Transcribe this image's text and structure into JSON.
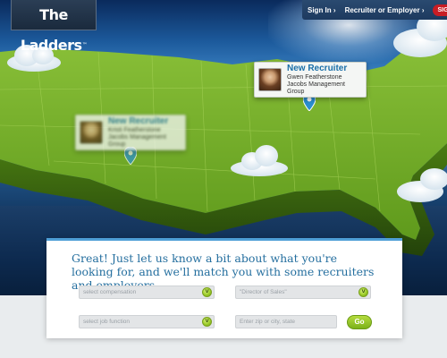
{
  "brand": {
    "logo_text": "The Ladders",
    "logo_mark": "™"
  },
  "topnav": {
    "sign_in": "Sign In ›",
    "recruiter_or_employer": "Recruiter or Employer ›",
    "sign_up": "SIGN UP"
  },
  "cards": [
    {
      "title": "New Recruiter",
      "name": "Gwen Featherstone",
      "company": "Jacobs Management Group"
    },
    {
      "title": "New Recruiter",
      "name": "Kristi Featherstone",
      "company": "Jacobs Management Group"
    }
  ],
  "form": {
    "headline": "Great! Just let us know a bit about what you're looking for, and we'll match you with some recruiters and employers.",
    "compensation": {
      "placeholder": "select compensation"
    },
    "title": {
      "value": "\"Director of Sales\""
    },
    "job_function": {
      "placeholder": "select job function"
    },
    "location": {
      "placeholder": "Enter zip or city, state"
    },
    "go_label": "Go"
  },
  "colors": {
    "accent": "#256f9f",
    "go": "#7cb11a",
    "signup": "#c81d24",
    "map_green": "#7fb42a"
  },
  "icons": {
    "dropdown": "chevron-down-icon",
    "pin": "map-pin-icon"
  }
}
